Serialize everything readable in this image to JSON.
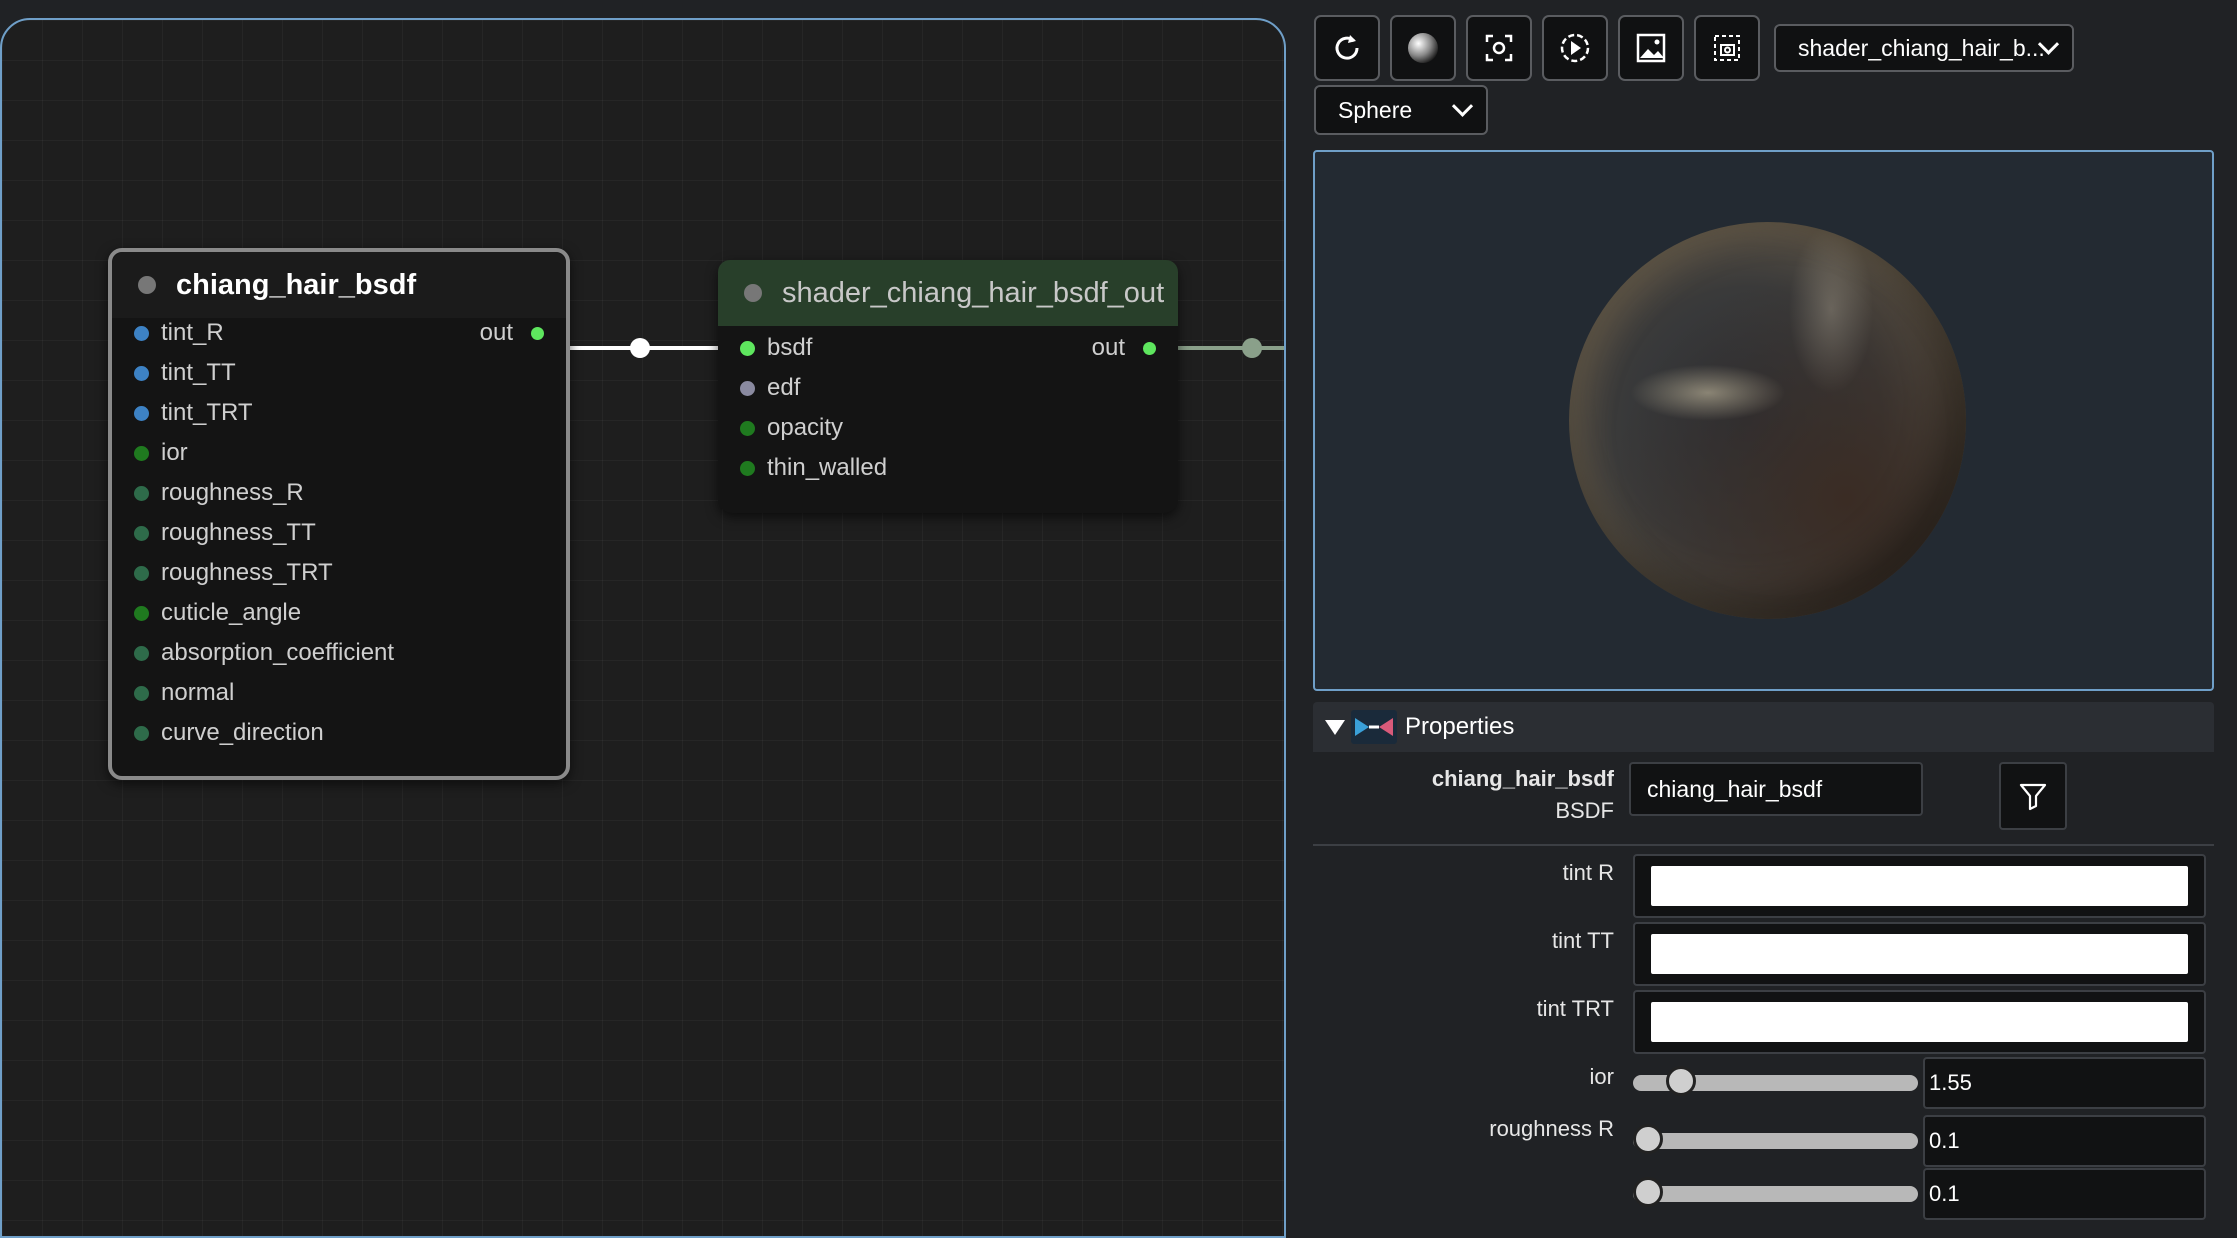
{
  "graph": {
    "node_hair": {
      "title": "chiang_hair_bsdf",
      "output": "out",
      "inputs": [
        {
          "label": "tint_R",
          "color": "#3d82c4"
        },
        {
          "label": "tint_TT",
          "color": "#3d82c4"
        },
        {
          "label": "tint_TRT",
          "color": "#3d82c4"
        },
        {
          "label": "ior",
          "color": "#1f7a1f"
        },
        {
          "label": "roughness_R",
          "color": "#2e6b4a"
        },
        {
          "label": "roughness_TT",
          "color": "#2e6b4a"
        },
        {
          "label": "roughness_TRT",
          "color": "#2e6b4a"
        },
        {
          "label": "cuticle_angle",
          "color": "#1f7a1f"
        },
        {
          "label": "absorption_coefficient",
          "color": "#2e6b4a"
        },
        {
          "label": "normal",
          "color": "#2e6b4a"
        },
        {
          "label": "curve_direction",
          "color": "#2e6b4a"
        }
      ]
    },
    "node_out": {
      "title": "shader_chiang_hair_bsdf_out",
      "output": "out",
      "inputs": [
        {
          "label": "bsdf",
          "color": "#5ee65e"
        },
        {
          "label": "edf",
          "color": "#8a8aa0"
        },
        {
          "label": "opacity",
          "color": "#1f7a1f"
        },
        {
          "label": "thin_walled",
          "color": "#1f7a1f"
        }
      ]
    },
    "wire_color": "#ffffff",
    "out_dot_color": "#5ee65e"
  },
  "toolbar": {
    "icons": [
      "reset-icon",
      "sphere-material-icon",
      "capture-icon",
      "play-icon",
      "image-icon",
      "capture-area-icon"
    ],
    "material_select": "shader_chiang_hair_b...",
    "geometry_select": "Sphere"
  },
  "properties": {
    "header": "Properties",
    "node_name": "chiang_hair_bsdf",
    "node_type": "BSDF",
    "name_value": "chiang_hair_bsdf",
    "tint_R_label": "tint R",
    "tint_TT_label": "tint TT",
    "tint_TRT_label": "tint TRT",
    "tint_color": "#ffffff",
    "ior_label": "ior",
    "ior_value": "1.55",
    "ior_fraction": 0.13,
    "roughness_R_label": "roughness R",
    "roughness_R_value": "0.1",
    "roughness_R_fraction": 0.0,
    "roughness_TT_value": "0.1",
    "roughness_TT_fraction": 0.0
  }
}
